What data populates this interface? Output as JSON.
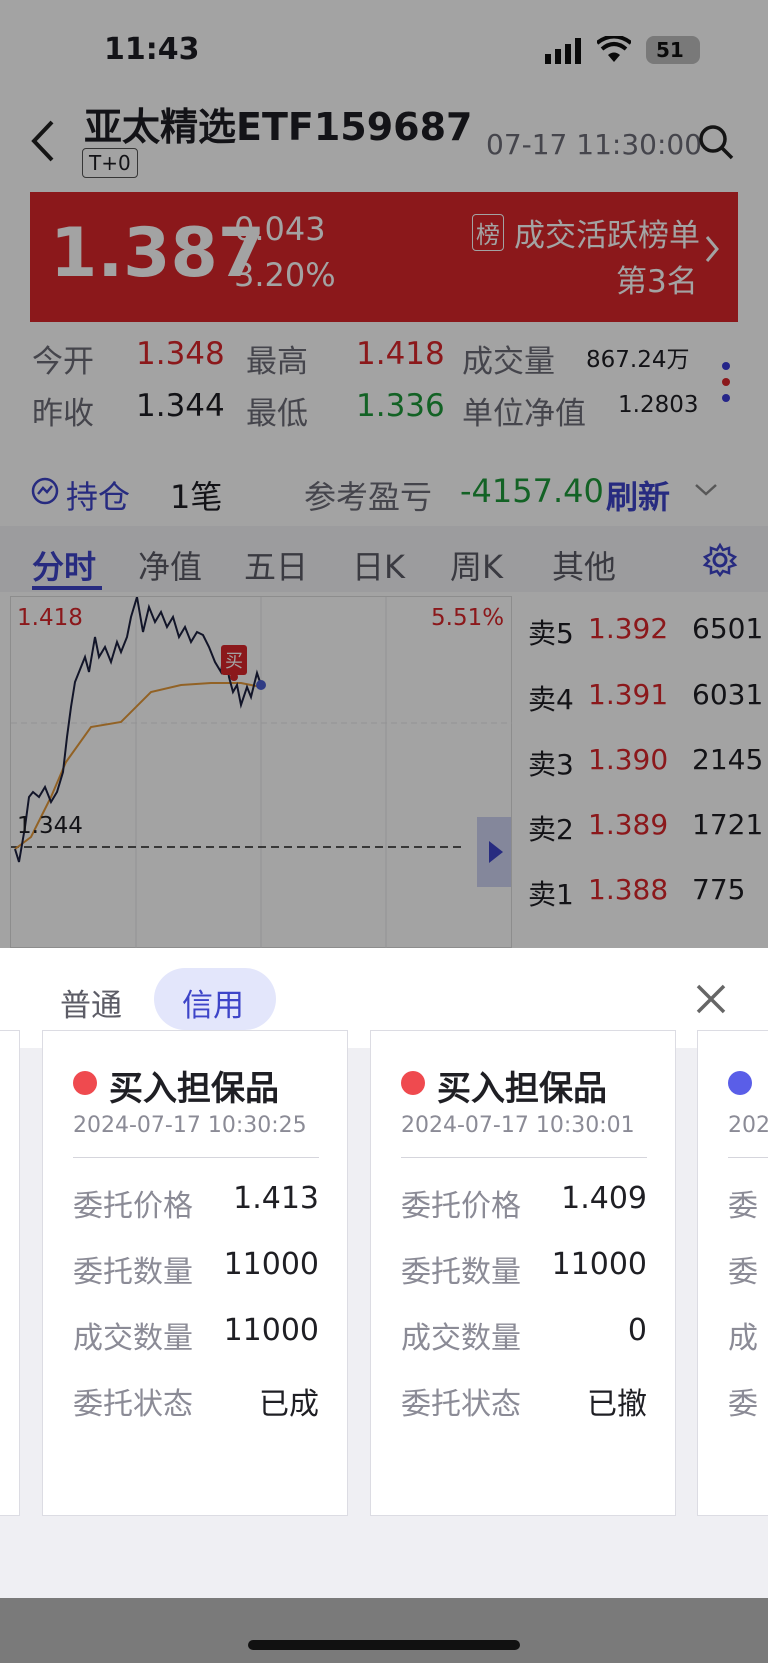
{
  "status_bar": {
    "time": "11:43",
    "battery": "51"
  },
  "header": {
    "title": "亚太精选ETF159687",
    "badge": "T+0",
    "datetime": "07-17 11:30:00"
  },
  "quote": {
    "price": "1.387",
    "change": "0.043",
    "change_pct": "3.20%",
    "rank_badge": "榜",
    "rank_title": "成交活跃榜单",
    "rank_value": "第3名"
  },
  "stats": {
    "open_label": "今开",
    "open": "1.348",
    "high_label": "最高",
    "high": "1.418",
    "volume_label": "成交量",
    "volume": "867.24万",
    "prev_close_label": "昨收",
    "prev_close": "1.344",
    "low_label": "最低",
    "low": "1.336",
    "nav_label": "单位净值",
    "nav": "1.2803"
  },
  "position": {
    "label": "持仓",
    "count": "1笔",
    "pnl_label": "参考盈亏",
    "pnl": "-4157.40",
    "refresh": "刷新"
  },
  "chart_tabs": [
    "分时",
    "净值",
    "五日",
    "日K",
    "周K",
    "其他"
  ],
  "chart": {
    "high_label": "1.418",
    "pct_label": "5.51%",
    "base_label": "1.344",
    "buy_marker": "买"
  },
  "order_book": [
    {
      "label": "卖5",
      "price": "1.392",
      "qty": "6501"
    },
    {
      "label": "卖4",
      "price": "1.391",
      "qty": "6031"
    },
    {
      "label": "卖3",
      "price": "1.390",
      "qty": "2145"
    },
    {
      "label": "卖2",
      "price": "1.389",
      "qty": "1721"
    },
    {
      "label": "卖1",
      "price": "1.388",
      "qty": "775"
    }
  ],
  "sheet": {
    "tab_normal": "普通",
    "tab_credit": "信用",
    "cards": [
      {
        "title": "买入担保品",
        "time": "2024-07-17 10:30:25",
        "price_label": "委托价格",
        "price": "1.413",
        "qty_label": "委托数量",
        "qty": "11000",
        "filled_label": "成交数量",
        "filled": "11000",
        "status_label": "委托状态",
        "status": "已成",
        "dot_color": "#ef4a4f"
      },
      {
        "title": "买入担保品",
        "time": "2024-07-17 10:30:01",
        "price_label": "委托价格",
        "price": "1.409",
        "qty_label": "委托数量",
        "qty": "11000",
        "filled_label": "成交数量",
        "filled": "0",
        "status_label": "委托状态",
        "status": "已撤",
        "dot_color": "#ef4a4f"
      }
    ],
    "partial_card": {
      "dot_color": "#5a5ee8",
      "title_fragment": "",
      "time_fragment": "202",
      "label_fragments": [
        "委",
        "委",
        "成",
        "委"
      ]
    }
  }
}
